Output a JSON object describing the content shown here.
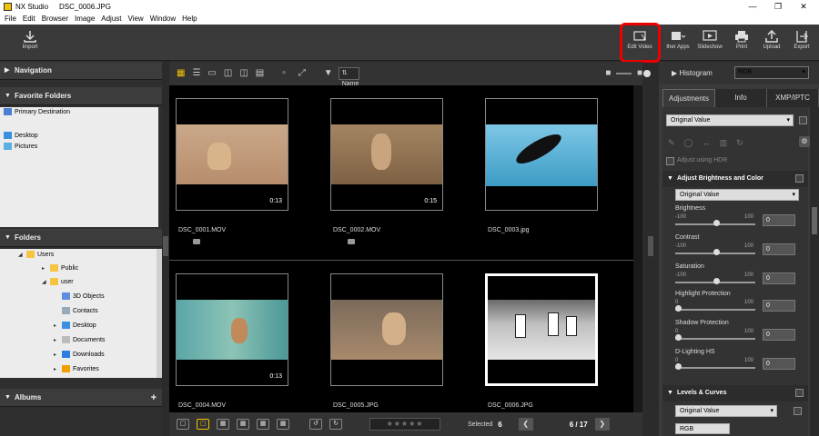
{
  "window": {
    "app": "NX Studio",
    "file": "DSC_0006.JPG"
  },
  "menu": [
    "File",
    "Edit",
    "Browser",
    "Image",
    "Adjust",
    "View",
    "Window",
    "Help"
  ],
  "toolbar": {
    "import": "Import",
    "edit_video": "Edit Video",
    "other_apps": "ther Apps",
    "slideshow": "Slideshow",
    "print": "Print",
    "upload": "Upload",
    "export": "Export"
  },
  "left": {
    "navigation": "Navigation",
    "favorite_folders": "Favorite Folders",
    "favorites": [
      "Primary Destination",
      "Desktop",
      "Pictures"
    ],
    "folders": "Folders",
    "tree": [
      "Users",
      "Public",
      "user",
      "3D Objects",
      "Contacts",
      "Desktop",
      "Documents",
      "Downloads",
      "Favorites"
    ],
    "albums": "Albums"
  },
  "grid": {
    "sort": "Name",
    "items": [
      {
        "name": "DSC_0001.MOV",
        "dur": "0:13"
      },
      {
        "name": "DSC_0002.MOV",
        "dur": "0:15"
      },
      {
        "name": "DSC_0003.jpg",
        "dur": ""
      },
      {
        "name": "DSC_0004.MOV",
        "dur": "0:13"
      },
      {
        "name": "DSC_0005.JPG",
        "dur": ""
      },
      {
        "name": "DSC_0006.JPG",
        "dur": ""
      }
    ],
    "selected_label": "Selected",
    "selected_count": "6",
    "page": "6 / 17"
  },
  "right": {
    "histogram": "Histogram",
    "channel": "RGB",
    "tabs": [
      "Adjustments",
      "Info",
      "XMP/IPTC"
    ],
    "preset": "Original Value",
    "hdr": "Adjust using HDR",
    "section": "Adjust Brightness and Color",
    "section_preset": "Original Value",
    "sliders": [
      {
        "name": "Brightness",
        "min": "-100",
        "max": "100",
        "val": "0"
      },
      {
        "name": "Contrast",
        "min": "-100",
        "max": "100",
        "val": "0"
      },
      {
        "name": "Saturation",
        "min": "-100",
        "max": "100",
        "val": "0"
      },
      {
        "name": "Highlight Protection",
        "min": "0",
        "max": "100",
        "val": "0"
      },
      {
        "name": "Shadow Protection",
        "min": "0",
        "max": "100",
        "val": "0"
      },
      {
        "name": "D-Lighting HS",
        "min": "0",
        "max": "100",
        "val": "0"
      }
    ],
    "levels": "Levels & Curves",
    "levels_preset": "Original Value",
    "levels_channel": "RGB"
  }
}
